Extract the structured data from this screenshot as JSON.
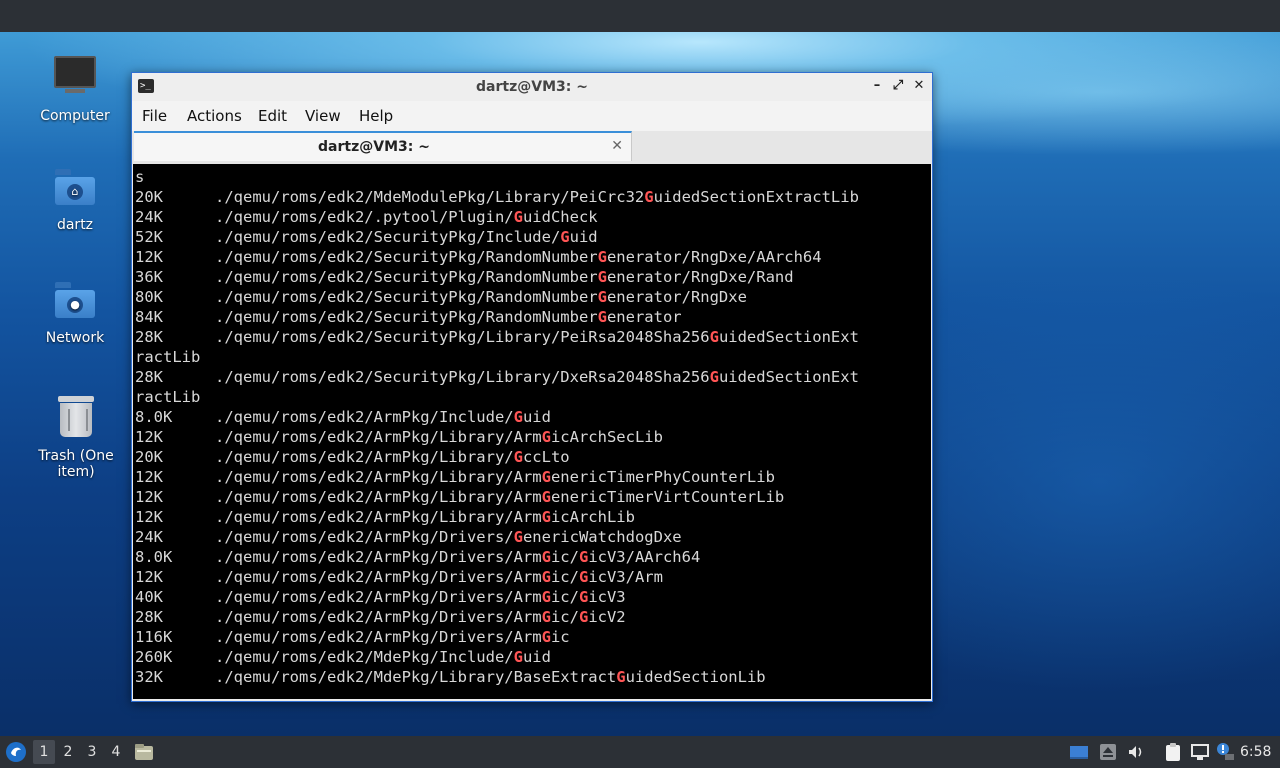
{
  "desktop": {
    "icons": [
      {
        "label": "Computer",
        "icon": "computer-icon"
      },
      {
        "label": "dartz",
        "icon": "home-folder-icon"
      },
      {
        "label": "Network",
        "icon": "network-folder-icon"
      },
      {
        "label": "Trash (One item)",
        "icon": "trash-icon"
      }
    ]
  },
  "window": {
    "title": "dartz@VM3: ~",
    "controls": {
      "minimize": "–",
      "maximize": "⤢",
      "close": "✕"
    },
    "menu": [
      "File",
      "Actions",
      "Edit",
      "View",
      "Help"
    ],
    "tab": {
      "label": "dartz@VM3: ~",
      "close": "✕"
    }
  },
  "terminal": {
    "highlight_color": "#ff5555",
    "lines": [
      {
        "size": "",
        "parts": [
          "s"
        ]
      },
      {
        "size": "20K",
        "parts": [
          "./qemu/roms/edk2/MdeModulePkg/Library/PeiCrc32",
          "G",
          "uidedSectionExtractLib"
        ]
      },
      {
        "size": "24K",
        "parts": [
          "./qemu/roms/edk2/.pytool/Plugin/",
          "G",
          "uidCheck"
        ]
      },
      {
        "size": "52K",
        "parts": [
          "./qemu/roms/edk2/SecurityPkg/Include/",
          "G",
          "uid"
        ]
      },
      {
        "size": "12K",
        "parts": [
          "./qemu/roms/edk2/SecurityPkg/RandomNumber",
          "G",
          "enerator/RngDxe/AArch64"
        ]
      },
      {
        "size": "36K",
        "parts": [
          "./qemu/roms/edk2/SecurityPkg/RandomNumber",
          "G",
          "enerator/RngDxe/Rand"
        ]
      },
      {
        "size": "80K",
        "parts": [
          "./qemu/roms/edk2/SecurityPkg/RandomNumber",
          "G",
          "enerator/RngDxe"
        ]
      },
      {
        "size": "84K",
        "parts": [
          "./qemu/roms/edk2/SecurityPkg/RandomNumber",
          "G",
          "enerator"
        ]
      },
      {
        "size": "28K",
        "parts": [
          "./qemu/roms/edk2/SecurityPkg/Library/PeiRsa2048Sha256",
          "G",
          "uidedSectionExt"
        ]
      },
      {
        "size": "",
        "parts": [
          "ractLib"
        ]
      },
      {
        "size": "28K",
        "parts": [
          "./qemu/roms/edk2/SecurityPkg/Library/DxeRsa2048Sha256",
          "G",
          "uidedSectionExt"
        ]
      },
      {
        "size": "",
        "parts": [
          "ractLib"
        ]
      },
      {
        "size": "8.0K",
        "parts": [
          "./qemu/roms/edk2/ArmPkg/Include/",
          "G",
          "uid"
        ]
      },
      {
        "size": "12K",
        "parts": [
          "./qemu/roms/edk2/ArmPkg/Library/Arm",
          "G",
          "icArchSecLib"
        ]
      },
      {
        "size": "20K",
        "parts": [
          "./qemu/roms/edk2/ArmPkg/Library/",
          "G",
          "ccLto"
        ]
      },
      {
        "size": "12K",
        "parts": [
          "./qemu/roms/edk2/ArmPkg/Library/Arm",
          "G",
          "enericTimerPhyCounterLib"
        ]
      },
      {
        "size": "12K",
        "parts": [
          "./qemu/roms/edk2/ArmPkg/Library/Arm",
          "G",
          "enericTimerVirtCounterLib"
        ]
      },
      {
        "size": "12K",
        "parts": [
          "./qemu/roms/edk2/ArmPkg/Library/Arm",
          "G",
          "icArchLib"
        ]
      },
      {
        "size": "24K",
        "parts": [
          "./qemu/roms/edk2/ArmPkg/Drivers/",
          "G",
          "enericWatchdogDxe"
        ]
      },
      {
        "size": "8.0K",
        "parts": [
          "./qemu/roms/edk2/ArmPkg/Drivers/Arm",
          "G",
          "ic/",
          "G",
          "icV3/AArch64"
        ]
      },
      {
        "size": "12K",
        "parts": [
          "./qemu/roms/edk2/ArmPkg/Drivers/Arm",
          "G",
          "ic/",
          "G",
          "icV3/Arm"
        ]
      },
      {
        "size": "40K",
        "parts": [
          "./qemu/roms/edk2/ArmPkg/Drivers/Arm",
          "G",
          "ic/",
          "G",
          "icV3"
        ]
      },
      {
        "size": "28K",
        "parts": [
          "./qemu/roms/edk2/ArmPkg/Drivers/Arm",
          "G",
          "ic/",
          "G",
          "icV2"
        ]
      },
      {
        "size": "116K",
        "parts": [
          "./qemu/roms/edk2/ArmPkg/Drivers/Arm",
          "G",
          "ic"
        ]
      },
      {
        "size": "260K",
        "parts": [
          "./qemu/roms/edk2/MdePkg/Include/",
          "G",
          "uid"
        ]
      },
      {
        "size": "32K",
        "parts": [
          "./qemu/roms/edk2/MdePkg/Library/BaseExtract",
          "G",
          "uidedSectionLib"
        ]
      }
    ]
  },
  "taskbar": {
    "workspaces": [
      "1",
      "2",
      "3",
      "4"
    ],
    "active_workspace": "1",
    "tray_icons": [
      "show-desktop-icon",
      "eject-icon",
      "volume-icon",
      "clipboard-icon",
      "network-icon",
      "notification-icon"
    ],
    "clock": "6:58"
  }
}
